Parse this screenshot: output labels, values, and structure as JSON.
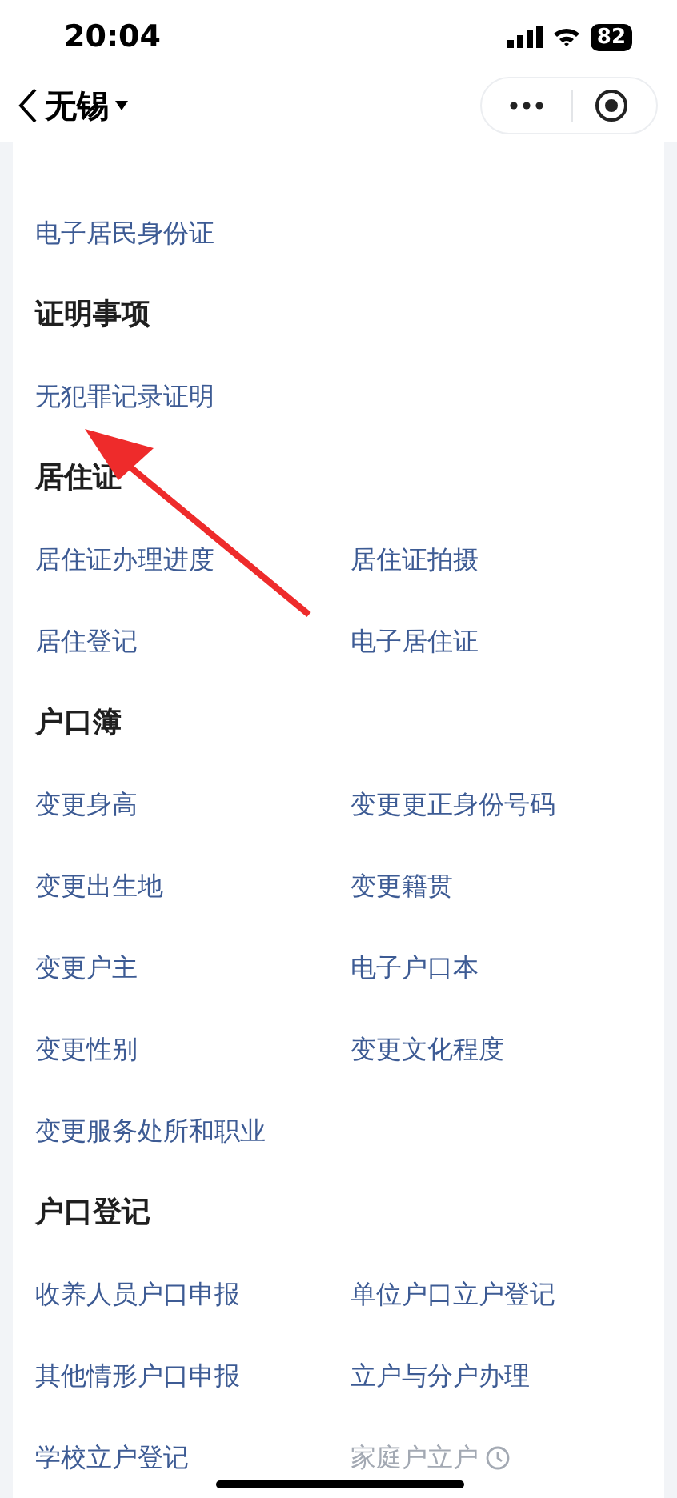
{
  "status_bar": {
    "time": "20:04",
    "battery": "82"
  },
  "nav": {
    "title": "无锡"
  },
  "sections": [
    {
      "items": [
        {
          "label": "电子居民身份证",
          "disabled": false
        }
      ]
    },
    {
      "title": "证明事项",
      "items": [
        {
          "label": "无犯罪记录证明",
          "disabled": false
        }
      ]
    },
    {
      "title": "居住证",
      "items": [
        {
          "label": "居住证办理进度",
          "disabled": false
        },
        {
          "label": "居住证拍摄",
          "disabled": false
        },
        {
          "label": "居住登记",
          "disabled": false
        },
        {
          "label": "电子居住证",
          "disabled": false
        }
      ]
    },
    {
      "title": "户口簿",
      "items": [
        {
          "label": "变更身高",
          "disabled": false
        },
        {
          "label": "变更更正身份号码",
          "disabled": false
        },
        {
          "label": "变更出生地",
          "disabled": false
        },
        {
          "label": "变更籍贯",
          "disabled": false
        },
        {
          "label": "变更户主",
          "disabled": false
        },
        {
          "label": "电子户口本",
          "disabled": false
        },
        {
          "label": "变更性别",
          "disabled": false
        },
        {
          "label": "变更文化程度",
          "disabled": false
        },
        {
          "label": "变更服务处所和职业",
          "disabled": false
        }
      ]
    },
    {
      "title": "户口登记",
      "items": [
        {
          "label": "收养人员户口申报",
          "disabled": false
        },
        {
          "label": "单位户口立户登记",
          "disabled": false
        },
        {
          "label": "其他情形户口申报",
          "disabled": false
        },
        {
          "label": "立户与分户办理",
          "disabled": false
        },
        {
          "label": "学校立户登记",
          "disabled": false
        },
        {
          "label": "家庭户立户",
          "disabled": true
        }
      ]
    }
  ]
}
